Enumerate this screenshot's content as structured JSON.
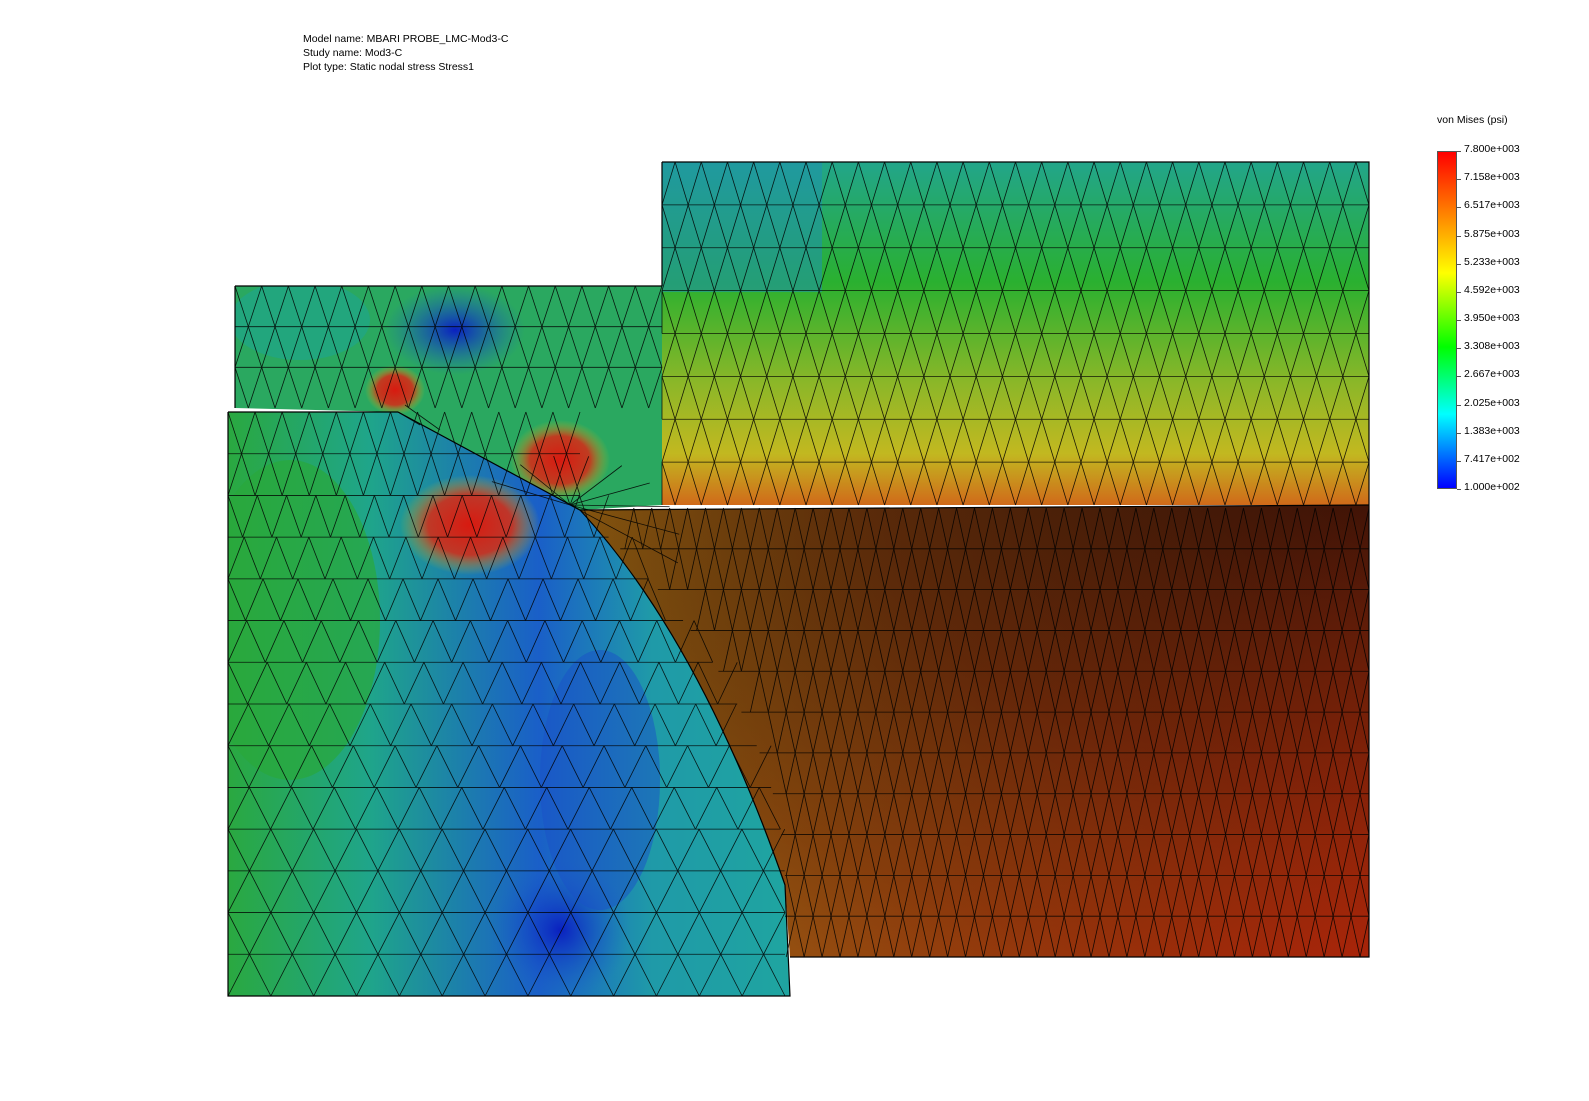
{
  "info": {
    "model_name": "Model name: MBARI PROBE_LMC-Mod3-C",
    "study_name": "Study name: Mod3-C",
    "plot_type": "Plot type: Static nodal stress Stress1"
  },
  "legend": {
    "title": "von Mises (psi)",
    "labels": [
      "7.800e+003",
      "7.158e+003",
      "6.517e+003",
      "5.875e+003",
      "5.233e+003",
      "4.592e+003",
      "3.950e+003",
      "3.308e+003",
      "2.667e+003",
      "2.025e+003",
      "1.383e+003",
      "7.417e+002",
      "1.000e+002"
    ],
    "colors": [
      "#ff0000",
      "#ff8000",
      "#ffff00",
      "#00ff00",
      "#00ffff",
      "#0000ff"
    ]
  },
  "palette": {
    "blue": "#1a4fc8",
    "teal": "#1fa59a",
    "green": "#34b22a",
    "yellow": "#c8c020",
    "red": "#d62a18",
    "dark": "#2a0c05",
    "mesh": "#000000"
  }
}
